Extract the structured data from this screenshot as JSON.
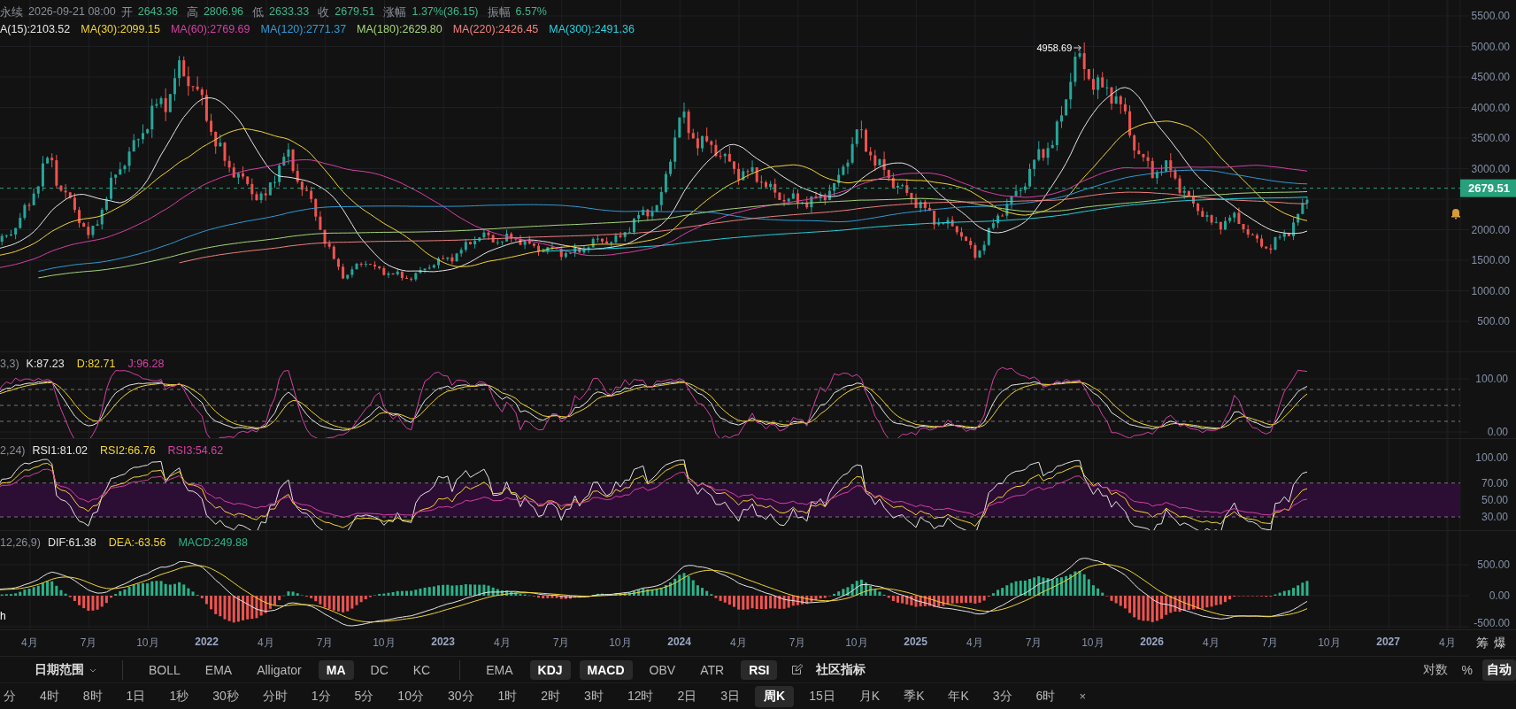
{
  "header": {
    "symbol": "永续",
    "datetime": "2026-09-21 08:00",
    "quote": [
      {
        "label": "开",
        "value": "2643.36"
      },
      {
        "label": "高",
        "value": "2806.96"
      },
      {
        "label": "低",
        "value": "2633.33"
      },
      {
        "label": "收",
        "value": "2679.51"
      },
      {
        "label": "涨幅",
        "value": "1.37%(36.15)"
      },
      {
        "label": "振幅",
        "value": "6.57%"
      }
    ]
  },
  "ma_legend": [
    {
      "label": "A(15):2103.52",
      "color": "#e6e6e6"
    },
    {
      "label": "MA(30):2099.15",
      "color": "#f2d530"
    },
    {
      "label": "MA(60):2769.69",
      "color": "#d63fa6"
    },
    {
      "label": "MA(120):2771.37",
      "color": "#2f9bd8"
    },
    {
      "label": "MA(180):2629.80",
      "color": "#a6d67a"
    },
    {
      "label": "MA(220):2426.45",
      "color": "#f08080"
    },
    {
      "label": "MA(300):2491.36",
      "color": "#22d3e0"
    }
  ],
  "price_axis": {
    "ticks": [
      "5500.00",
      "5000.00",
      "4500.00",
      "4000.00",
      "3500.00",
      "3000.00",
      "2000.00",
      "1500.00",
      "1000.00",
      "500.00"
    ],
    "last_price": "2679.51",
    "peak_label": "4958.69"
  },
  "kdj": {
    "params": "3,3)",
    "items": [
      {
        "label": "K:87.23",
        "color": "#e6e6e6"
      },
      {
        "label": "D:82.71",
        "color": "#f2d530"
      },
      {
        "label": "J:96.28",
        "color": "#d63fa6"
      }
    ],
    "ticks": [
      "100.00",
      "0.00"
    ]
  },
  "rsi": {
    "params": "2,24)",
    "items": [
      {
        "label": "RSI1:81.02",
        "color": "#e6e6e6"
      },
      {
        "label": "RSI2:66.76",
        "color": "#f2d530"
      },
      {
        "label": "RSI3:54.62",
        "color": "#d63fa6"
      }
    ],
    "ticks": [
      "100.00",
      "70.00",
      "50.00",
      "30.00"
    ]
  },
  "macd": {
    "params": "12,26,9)",
    "items": [
      {
        "label": "DIF:61.38",
        "color": "#e6e6e6"
      },
      {
        "label": "DEA:-63.56",
        "color": "#f2d530"
      },
      {
        "label": "MACD:249.88",
        "color": "#2bb38a"
      }
    ],
    "ticks": [
      "500.00",
      "0.00",
      "-500.00"
    ],
    "footer": "h"
  },
  "date_axis": [
    {
      "label": "4月",
      "kind": "month"
    },
    {
      "label": "7月",
      "kind": "month"
    },
    {
      "label": "10月",
      "kind": "month"
    },
    {
      "label": "2022",
      "kind": "year"
    },
    {
      "label": "4月",
      "kind": "month"
    },
    {
      "label": "7月",
      "kind": "month"
    },
    {
      "label": "10月",
      "kind": "month"
    },
    {
      "label": "2023",
      "kind": "year"
    },
    {
      "label": "4月",
      "kind": "month"
    },
    {
      "label": "7月",
      "kind": "month"
    },
    {
      "label": "10月",
      "kind": "month"
    },
    {
      "label": "2024",
      "kind": "year"
    },
    {
      "label": "4月",
      "kind": "month"
    },
    {
      "label": "7月",
      "kind": "month"
    },
    {
      "label": "10月",
      "kind": "month"
    },
    {
      "label": "2025",
      "kind": "year"
    },
    {
      "label": "4月",
      "kind": "month"
    },
    {
      "label": "7月",
      "kind": "month"
    },
    {
      "label": "10月",
      "kind": "month"
    },
    {
      "label": "2026",
      "kind": "year"
    },
    {
      "label": "4月",
      "kind": "month"
    },
    {
      "label": "7月",
      "kind": "month"
    },
    {
      "label": "10月",
      "kind": "month"
    },
    {
      "label": "2027",
      "kind": "year"
    },
    {
      "label": "4月",
      "kind": "month"
    }
  ],
  "corner_labels": [
    "筹",
    "爆"
  ],
  "indicator_bar": {
    "date_range": "日期范围",
    "main": [
      {
        "label": "BOLL",
        "selected": false
      },
      {
        "label": "EMA",
        "selected": false
      },
      {
        "label": "Alligator",
        "selected": false
      },
      {
        "label": "MA",
        "selected": true
      },
      {
        "label": "DC",
        "selected": false
      },
      {
        "label": "KC",
        "selected": false
      }
    ],
    "sub": [
      {
        "label": "EMA",
        "selected": false
      },
      {
        "label": "KDJ",
        "selected": true
      },
      {
        "label": "MACD",
        "selected": true
      },
      {
        "label": "OBV",
        "selected": false
      },
      {
        "label": "ATR",
        "selected": false
      },
      {
        "label": "RSI",
        "selected": true
      }
    ],
    "community": "社区指标",
    "scale": [
      {
        "label": "对数",
        "selected": false
      },
      {
        "label": "%",
        "selected": false
      },
      {
        "label": "自动",
        "selected": true
      }
    ]
  },
  "intervals": [
    {
      "label": "分",
      "selected": false
    },
    {
      "label": "4时",
      "selected": false
    },
    {
      "label": "8时",
      "selected": false
    },
    {
      "label": "1日",
      "selected": false
    },
    {
      "label": "1秒",
      "selected": false
    },
    {
      "label": "30秒",
      "selected": false
    },
    {
      "label": "分时",
      "selected": false
    },
    {
      "label": "1分",
      "selected": false
    },
    {
      "label": "5分",
      "selected": false
    },
    {
      "label": "10分",
      "selected": false
    },
    {
      "label": "30分",
      "selected": false
    },
    {
      "label": "1时",
      "selected": false
    },
    {
      "label": "2时",
      "selected": false
    },
    {
      "label": "3时",
      "selected": false
    },
    {
      "label": "12时",
      "selected": false
    },
    {
      "label": "2日",
      "selected": false
    },
    {
      "label": "3日",
      "selected": false
    },
    {
      "label": "周K",
      "selected": true
    },
    {
      "label": "15日",
      "selected": false
    },
    {
      "label": "月K",
      "selected": false
    },
    {
      "label": "季K",
      "selected": false
    },
    {
      "label": "年K",
      "selected": false
    },
    {
      "label": "3分",
      "selected": false
    },
    {
      "label": "6时",
      "selected": false
    }
  ],
  "clear": "×"
}
